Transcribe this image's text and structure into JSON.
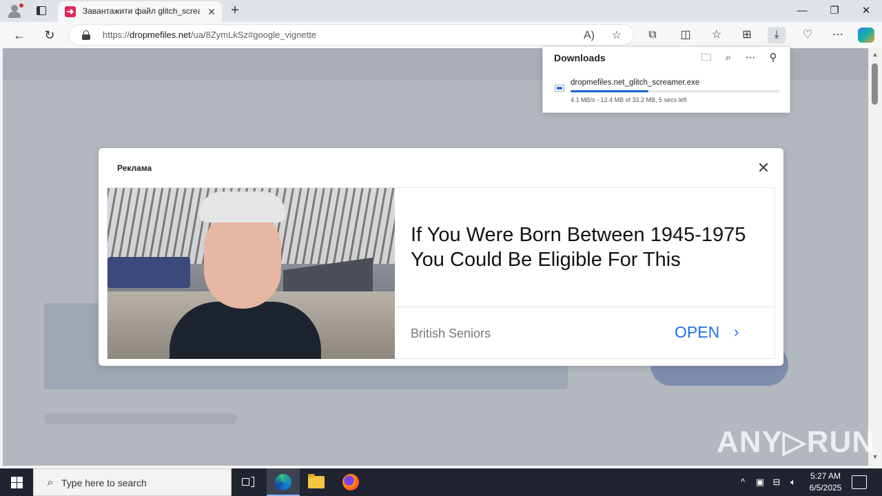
{
  "browser": {
    "tab": {
      "title": "Завантажити файл glitch_screamer.exe",
      "close_glyph": "✕"
    },
    "address_bar": {
      "url_scheme": "https://",
      "url_domain": "dropmefiles.net",
      "url_path": "/ua/8ZymLkSz#google_vignette"
    },
    "window_controls": {
      "minimize": "—",
      "maximize": "❐",
      "close": "✕"
    },
    "toolbar_icons": [
      "back-icon",
      "refresh-icon",
      "read-aloud-icon",
      "favorite-star-icon",
      "extensions-icon",
      "split-screen-icon",
      "favorites-icon",
      "collections-icon",
      "downloads-icon",
      "browser-essentials-icon",
      "more-icon",
      "copilot-icon"
    ]
  },
  "downloads": {
    "title": "Downloads",
    "item": {
      "filename": "dropmefiles.net_glitch_screamer.exe",
      "status": "4.1 MB/s - 12.4 MB of 33.2 MB, 5 secs left",
      "progress_fraction": 0.373
    }
  },
  "ad": {
    "label": "Реклама",
    "headline": "If You Were Born Between 1945-1975 You Could Be Eligible For This",
    "source": "British Seniors",
    "cta": "OPEN",
    "close_glyph": "✕"
  },
  "watermark": "ANY▷RUN",
  "taskbar": {
    "search_placeholder": "Type here to search",
    "time": "5:27 AM",
    "date": "6/5/2025"
  },
  "colors": {
    "accent": "#1a73e8",
    "download_progress": "#1a66c7",
    "favicon": "#e0245e"
  }
}
